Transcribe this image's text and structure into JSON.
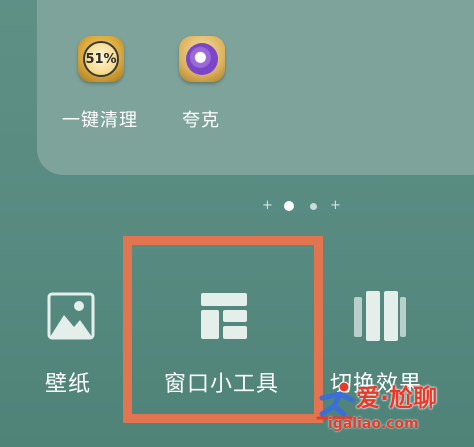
{
  "folder": {
    "apps": [
      {
        "label": "一键清理",
        "icon": "cleaner-icon",
        "badge": "51%"
      },
      {
        "label": "夸克",
        "icon": "quark-browser-icon"
      }
    ]
  },
  "page_indicator": {
    "pages": 4,
    "active": 1
  },
  "tools": [
    {
      "label": "壁纸",
      "icon": "wallpaper-icon"
    },
    {
      "label": "窗口小工具",
      "icon": "widgets-icon"
    },
    {
      "label": "切换效果",
      "icon": "transition-effect-icon"
    }
  ],
  "watermark": {
    "title": "爱·尬聊",
    "url": "igaliao.com"
  },
  "colors": {
    "background": "#5a8a7f",
    "folder": "#7ea39a",
    "highlight": "#e2744f",
    "watermark": "#e63b2a"
  }
}
